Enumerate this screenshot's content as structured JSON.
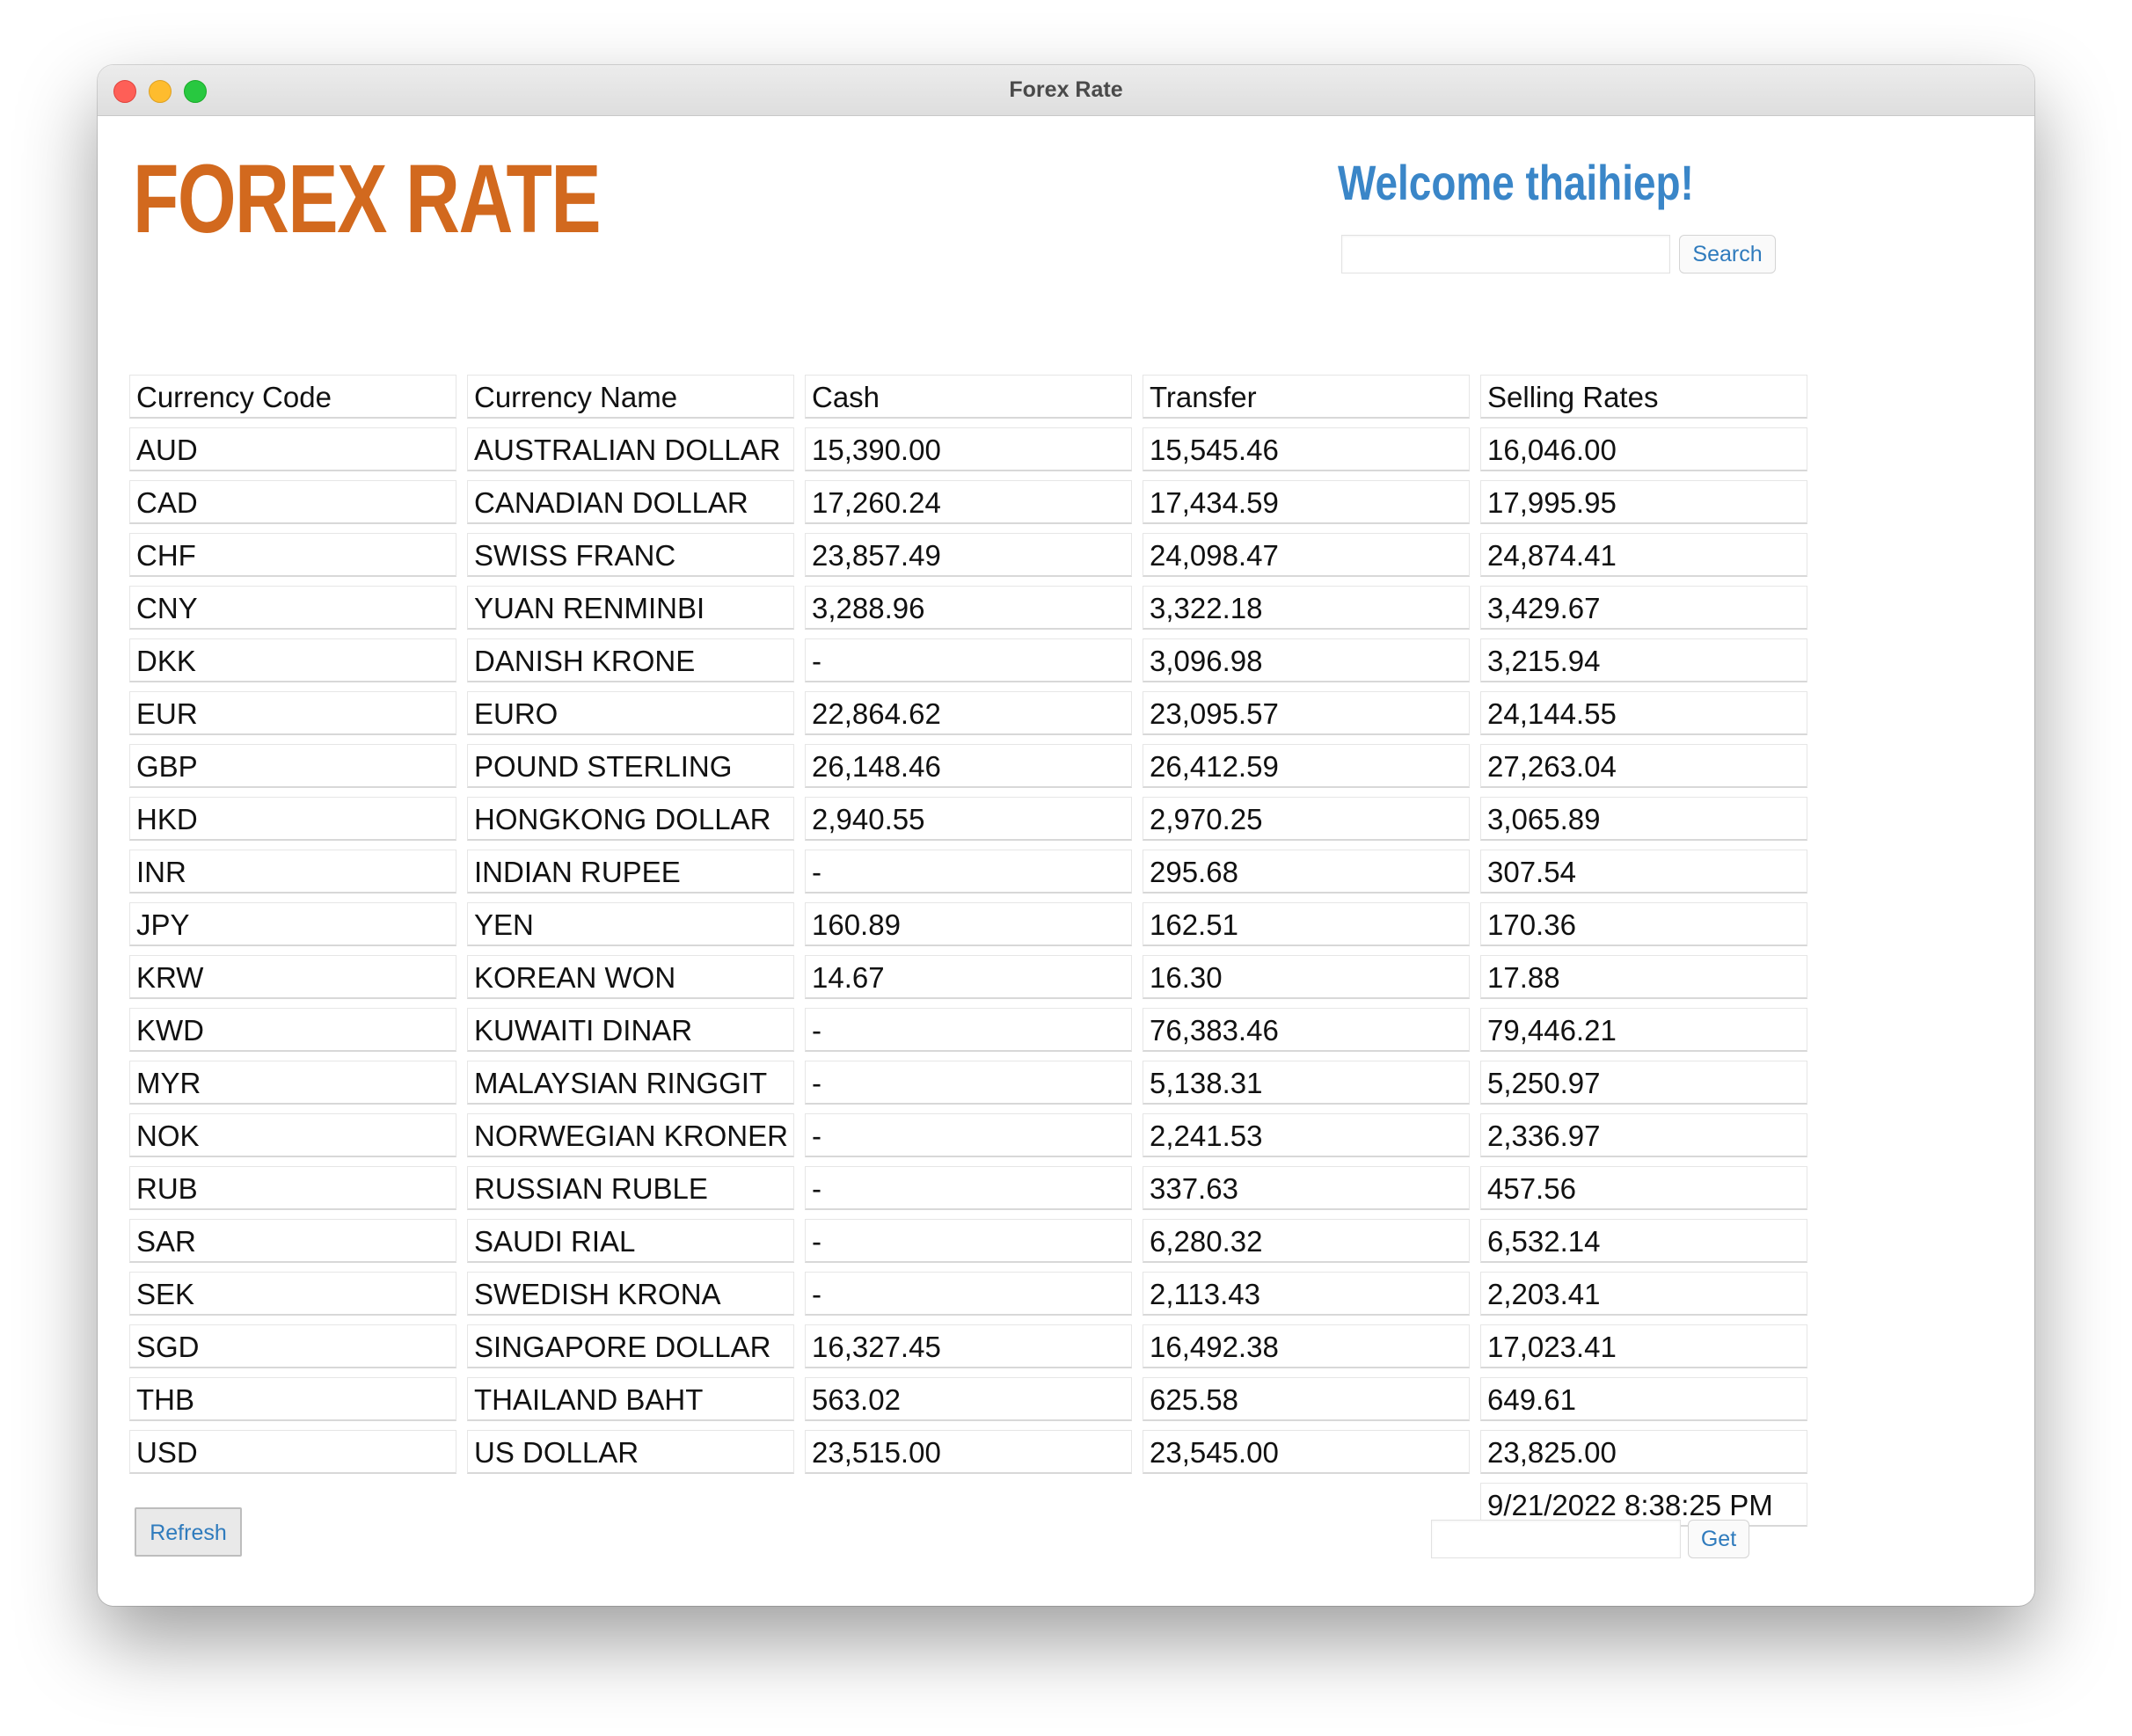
{
  "window": {
    "title": "Forex Rate"
  },
  "header": {
    "app_title": "FOREX RATE",
    "welcome": "Welcome thaihiep!",
    "search_label": "Search",
    "search_value": ""
  },
  "table": {
    "headers": [
      "Currency Code",
      "Currency Name",
      "Cash",
      "Transfer",
      "Selling Rates"
    ],
    "rows": [
      [
        "AUD",
        "AUSTRALIAN DOLLAR",
        "15,390.00",
        "15,545.46",
        "16,046.00"
      ],
      [
        "CAD",
        "CANADIAN DOLLAR",
        "17,260.24",
        "17,434.59",
        "17,995.95"
      ],
      [
        "CHF",
        "SWISS FRANC",
        "23,857.49",
        "24,098.47",
        "24,874.41"
      ],
      [
        "CNY",
        "YUAN RENMINBI",
        "3,288.96",
        "3,322.18",
        "3,429.67"
      ],
      [
        "DKK",
        "DANISH KRONE",
        "-",
        "3,096.98",
        "3,215.94"
      ],
      [
        "EUR",
        "EURO",
        "22,864.62",
        "23,095.57",
        "24,144.55"
      ],
      [
        "GBP",
        "POUND STERLING",
        "26,148.46",
        "26,412.59",
        "27,263.04"
      ],
      [
        "HKD",
        "HONGKONG DOLLAR",
        "2,940.55",
        "2,970.25",
        "3,065.89"
      ],
      [
        "INR",
        "INDIAN RUPEE",
        "-",
        "295.68",
        "307.54"
      ],
      [
        "JPY",
        "YEN",
        "160.89",
        "162.51",
        "170.36"
      ],
      [
        "KRW",
        "KOREAN WON",
        "14.67",
        "16.30",
        "17.88"
      ],
      [
        "KWD",
        "KUWAITI DINAR",
        "-",
        "76,383.46",
        "79,446.21"
      ],
      [
        "MYR",
        "MALAYSIAN RINGGIT",
        "-",
        "5,138.31",
        "5,250.97"
      ],
      [
        "NOK",
        "NORWEGIAN KRONER",
        "-",
        "2,241.53",
        "2,336.97"
      ],
      [
        "RUB",
        "RUSSIAN RUBLE",
        "-",
        "337.63",
        "457.56"
      ],
      [
        "SAR",
        "SAUDI RIAL",
        "-",
        "6,280.32",
        "6,532.14"
      ],
      [
        "SEK",
        "SWEDISH KRONA",
        "-",
        "2,113.43",
        "2,203.41"
      ],
      [
        "SGD",
        "SINGAPORE DOLLAR",
        "16,327.45",
        "16,492.38",
        "17,023.41"
      ],
      [
        "THB",
        "THAILAND BAHT",
        "563.02",
        "625.58",
        "649.61"
      ],
      [
        "USD",
        "US DOLLAR",
        "23,515.00",
        "23,545.00",
        "23,825.00"
      ]
    ],
    "timestamp": "9/21/2022 8:38:25 PM"
  },
  "footer": {
    "refresh_label": "Refresh",
    "get_label": "Get",
    "get_value": ""
  },
  "colors": {
    "title_orange": "#d2691e",
    "welcome_blue": "#3a86c8",
    "link_blue": "#2f7bbd"
  }
}
